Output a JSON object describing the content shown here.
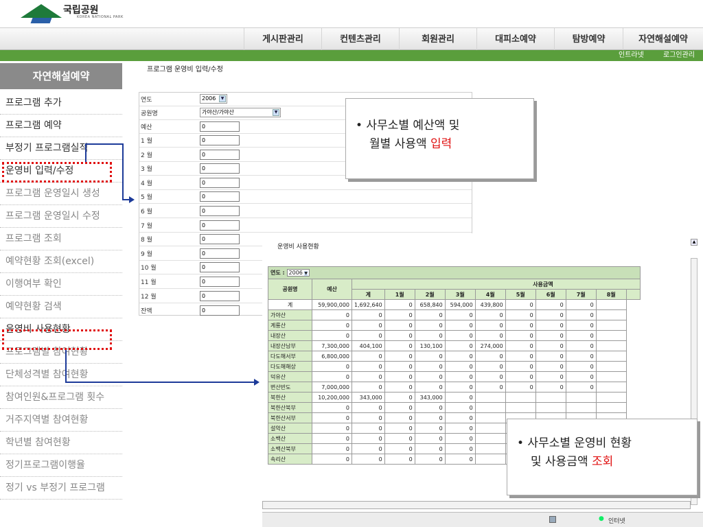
{
  "header": {
    "logo_title": "국립공원",
    "logo_sub": "KOREA NATIONAL PARK"
  },
  "nav": [
    "게시판관리",
    "컨텐츠관리",
    "회원관리",
    "대피소예약",
    "탐방예약",
    "자연해설예약"
  ],
  "util": {
    "intranet": "인트라넷",
    "logout": "로그인관리"
  },
  "sidebar": {
    "title": "자연해설예약",
    "items": [
      "프로그램 추가",
      "프로그램 예약",
      "부정기 프로그램실적",
      "운영비 입력/수정",
      "프로그램 운영일시 생성",
      "프로그램 운영일시 수정",
      "프로그램 조회",
      "예약현황 조회(excel)",
      "이행여부 확인",
      "예약현황 검색",
      "운영비 사용현황",
      "프로그램별 참여현황",
      "단체성격별 참여현황",
      "참여인원&프로그램 횟수",
      "거주지역별 참여현황",
      "학년별 참여현황",
      "정기프로그램이행율",
      "정기 vs 부정기 프로그램"
    ]
  },
  "form": {
    "title": "프로그램 운영비 입력/수정",
    "year_label": "연도",
    "year": "2006",
    "park_label": "공원명",
    "park": "가야산/가야산",
    "budget_label": "예산",
    "months": [
      "1 월",
      "2 월",
      "3 월",
      "4 월",
      "5 월",
      "6 월",
      "7 월",
      "8 월",
      "9 월",
      "10 월",
      "11 월",
      "12 월"
    ],
    "remain_label": "잔액",
    "zero": "0"
  },
  "callout1": {
    "line1_prefix": "• 사무소별 예산액 및",
    "line2_prefix": "월별 사용액 ",
    "line2_red": "입력"
  },
  "callout2": {
    "line1_prefix": "• 사무소별 운영비 현황",
    "line2_prefix": "및 사용금액 ",
    "line2_red": "조회"
  },
  "report": {
    "title": "운영비 사용현황",
    "year_label": "연도 :",
    "year": "2006",
    "col_park": "공원명",
    "col_budget": "예산",
    "col_used": "사용금액",
    "months": [
      "계",
      "1월",
      "2월",
      "3월",
      "4월",
      "5월",
      "6월",
      "7월",
      "8월"
    ],
    "rows": [
      [
        "계",
        "59,900,000",
        "1,692,640",
        "0",
        "658,840",
        "594,000",
        "439,800",
        "0",
        "0",
        "0",
        ""
      ],
      [
        "가야산",
        "0",
        "0",
        "0",
        "0",
        "0",
        "0",
        "0",
        "0",
        "0",
        ""
      ],
      [
        "계룡산",
        "0",
        "0",
        "0",
        "0",
        "0",
        "0",
        "0",
        "0",
        "0",
        ""
      ],
      [
        "내장산",
        "0",
        "0",
        "0",
        "0",
        "0",
        "0",
        "0",
        "0",
        "0",
        ""
      ],
      [
        "내장산남부",
        "7,300,000",
        "404,100",
        "0",
        "130,100",
        "0",
        "274,000",
        "0",
        "0",
        "0",
        ""
      ],
      [
        "다도해서부",
        "6,800,000",
        "0",
        "0",
        "0",
        "0",
        "0",
        "0",
        "0",
        "0",
        ""
      ],
      [
        "다도해해상",
        "0",
        "0",
        "0",
        "0",
        "0",
        "0",
        "0",
        "0",
        "0",
        ""
      ],
      [
        "덕유산",
        "0",
        "0",
        "0",
        "0",
        "0",
        "0",
        "0",
        "0",
        "0",
        ""
      ],
      [
        "변산반도",
        "7,000,000",
        "0",
        "0",
        "0",
        "0",
        "0",
        "0",
        "0",
        "0",
        ""
      ],
      [
        "북한산",
        "10,200,000",
        "343,000",
        "0",
        "343,000",
        "0",
        "",
        "",
        "",
        "",
        ""
      ],
      [
        "북한산북부",
        "0",
        "0",
        "0",
        "0",
        "0",
        "",
        "",
        "",
        "",
        ""
      ],
      [
        "북한산서부",
        "0",
        "0",
        "0",
        "0",
        "0",
        "",
        "",
        "",
        "",
        ""
      ],
      [
        "설악산",
        "0",
        "0",
        "0",
        "0",
        "0",
        "",
        "",
        "",
        "",
        ""
      ],
      [
        "소백산",
        "0",
        "0",
        "0",
        "0",
        "0",
        "",
        "",
        "",
        "",
        ""
      ],
      [
        "소백산북부",
        "0",
        "0",
        "0",
        "0",
        "0",
        "",
        "",
        "",
        "",
        ""
      ],
      [
        "속리산",
        "0",
        "0",
        "0",
        "0",
        "0",
        "",
        "",
        "",
        "",
        ""
      ]
    ],
    "status_zone": "인터넷"
  }
}
